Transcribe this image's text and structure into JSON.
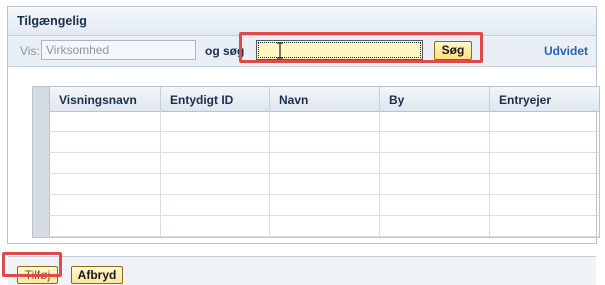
{
  "panel": {
    "title": "Tilgængelig"
  },
  "toolbar": {
    "vis_label": "Vis:",
    "vis_value": "Virksomhed",
    "og_label": "og søg",
    "search_value": "",
    "search_button": "Søg",
    "advanced_link": "Udvidet"
  },
  "table": {
    "columns": [
      "Visningsnavn",
      "Entydigt ID",
      "Navn",
      "By",
      "Entryejer"
    ],
    "rows": [
      [
        "",
        "",
        "",
        "",
        ""
      ],
      [
        "",
        "",
        "",
        "",
        ""
      ],
      [
        "",
        "",
        "",
        "",
        ""
      ],
      [
        "",
        "",
        "",
        "",
        ""
      ],
      [
        "",
        "",
        "",
        "",
        ""
      ],
      [
        "",
        "",
        "",
        "",
        ""
      ]
    ]
  },
  "footer": {
    "add_button": "Tilføj",
    "cancel_button": "Afbryd"
  },
  "colors": {
    "highlight": "#e04a4a",
    "header_text": "#1a2f4d",
    "link": "#2a62b0",
    "input_active": "#fff7c2"
  },
  "icons": {
    "cursor": "text-cursor-icon"
  }
}
